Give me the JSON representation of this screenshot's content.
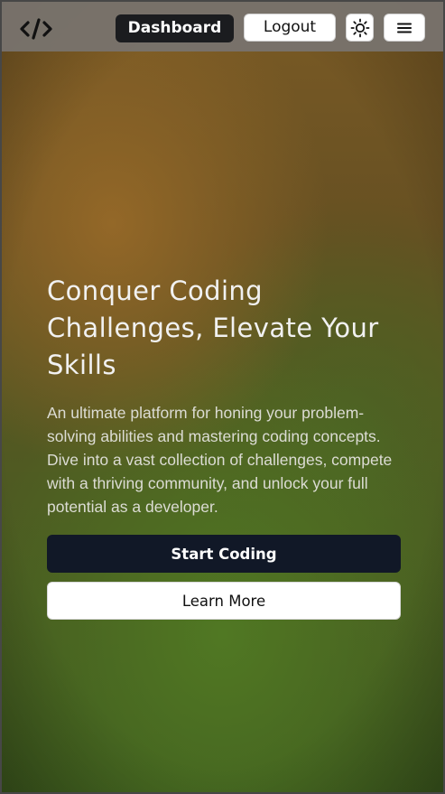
{
  "navbar": {
    "logo_icon": "code-brackets-icon",
    "dashboard_label": "Dashboard",
    "logout_label": "Logout",
    "theme_icon": "sun-icon",
    "menu_icon": "hamburger-menu-icon"
  },
  "hero": {
    "title": "Conquer Coding Challenges, Elevate Your Skills",
    "description": "An ultimate platform for honing your problem-solving abilities and mastering coding concepts. Dive into a vast collection of challenges, compete with a thriving community, and unlock your full potential as a developer.",
    "start_label": "Start Coding",
    "learn_label": "Learn More"
  },
  "colors": {
    "dark_button": "#111827",
    "dashboard_button": "#1b1c1f",
    "light_button": "#ffffff",
    "navbar": "#78736e"
  }
}
